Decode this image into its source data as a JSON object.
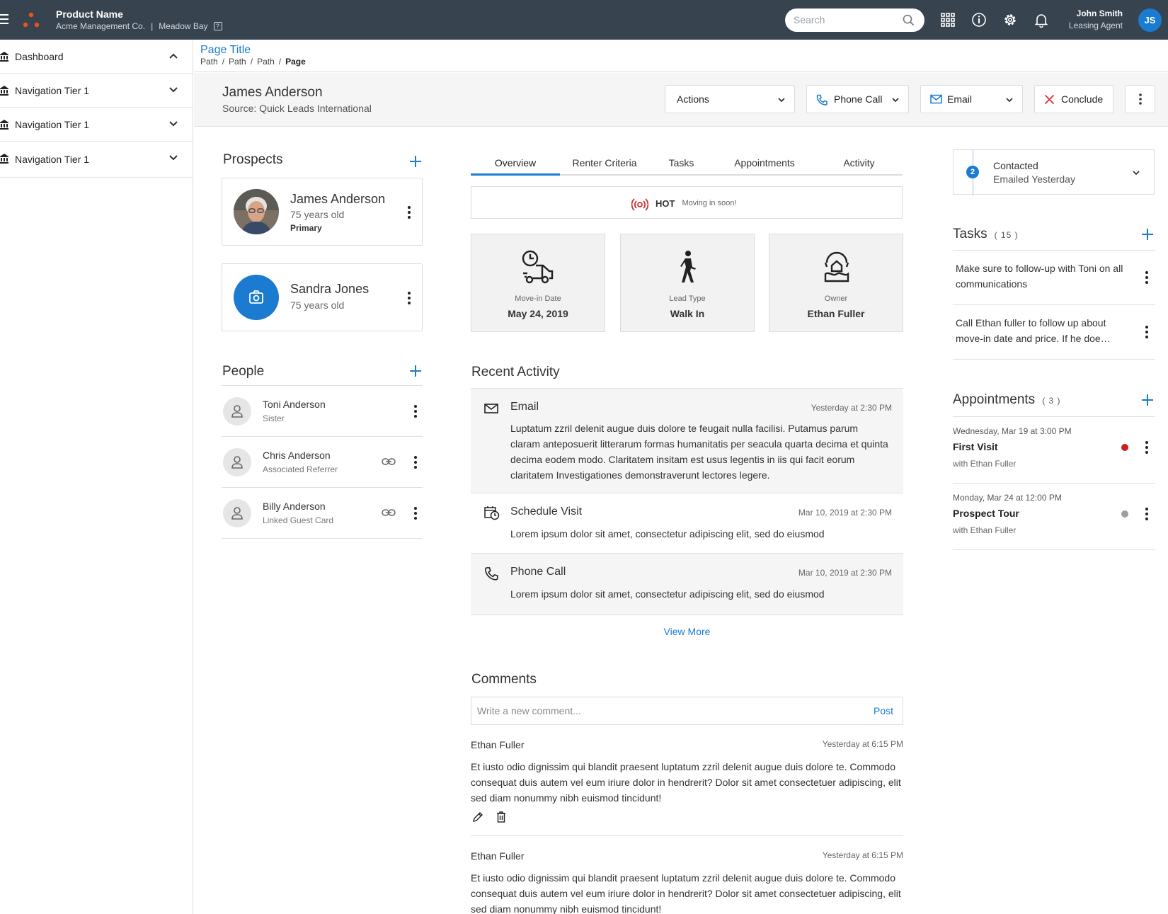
{
  "app": {
    "product_name": "Product Name",
    "company": "Acme Management Co.",
    "separator": "|",
    "property": "Meadow Bay",
    "help_icon": "?",
    "search_placeholder": "Search",
    "user_name": "John Smith",
    "user_role": "Leasing Agent",
    "user_initials": "JS",
    "accent_color": "#1a7bd1",
    "topbar_color": "#37434f",
    "logo_color": "#e8541e"
  },
  "sidebar": {
    "items": [
      {
        "label": "Dashboard",
        "icon": "bank-icon",
        "state": "expanded"
      },
      {
        "label": "Navigation Tier 1",
        "icon": "bank-icon",
        "state": "collapsed"
      },
      {
        "label": "Navigation Tier 1",
        "icon": "bank-icon",
        "state": "collapsed"
      },
      {
        "label": "Navigation Tier 1",
        "icon": "bank-icon",
        "state": "collapsed"
      }
    ]
  },
  "page": {
    "title": "Page Title",
    "breadcrumb": [
      "Path",
      "/",
      "Path",
      "/",
      "Path",
      "/",
      "Page"
    ]
  },
  "record": {
    "name": "James Anderson",
    "source": "Source: Quick Leads International",
    "actions_label": "Actions",
    "phone_label": "Phone Call",
    "email_label": "Email",
    "conclude_label": "Conclude"
  },
  "prospects": {
    "title": "Prospects",
    "items": [
      {
        "name": "James Anderson",
        "age": "75 years old",
        "tag": "Primary"
      },
      {
        "name": "Sandra Jones",
        "age": "75 years old",
        "tag": ""
      }
    ]
  },
  "people": {
    "title": "People",
    "items": [
      {
        "name": "Toni Anderson",
        "relation": "Sister",
        "linked": false
      },
      {
        "name": "Chris Anderson",
        "relation": "Associated Referrer",
        "linked": true
      },
      {
        "name": "Billy Anderson",
        "relation": "Linked Guest Card",
        "linked": true
      }
    ]
  },
  "tabs": [
    "Overview",
    "Renter Criteria",
    "Tasks",
    "Appointments",
    "Activity"
  ],
  "active_tab": "Overview",
  "hot": {
    "label": "HOT",
    "note": "Moving in soon!",
    "color": "#d32f2f"
  },
  "stats": [
    {
      "label": "Move-in Date",
      "value": "May 24, 2019",
      "icon": "moving-truck-icon"
    },
    {
      "label": "Lead Type",
      "value": "Walk In",
      "icon": "walking-person-icon"
    },
    {
      "label": "Owner",
      "value": "Ethan Fuller",
      "icon": "owner-icon"
    }
  ],
  "recent_activity": {
    "title": "Recent Activity",
    "items": [
      {
        "type": "Email",
        "icon": "envelope-icon",
        "date": "Yesterday at 2:30 PM",
        "body": "Luptatum zzril delenit augue duis dolore te feugait nulla facilisi. Putamus parum claram anteposuerit litterarum formas humanitatis per seacula quarta decima et quinta decima eodem modo. Claritatem insitam est usus legentis in iis qui facit eorum claritatem Investigationes demonstraverunt lectores legere."
      },
      {
        "type": "Schedule Visit",
        "icon": "calendar-clock-icon",
        "date": "Mar 10, 2019 at 2:30 PM",
        "body": "Lorem ipsum dolor sit amet, consectetur adipiscing elit, sed do eiusmod"
      },
      {
        "type": "Phone Call",
        "icon": "phone-icon",
        "date": "Mar 10, 2019 at 2:30 PM",
        "body": "Lorem ipsum dolor sit amet, consectetur adipiscing elit, sed do eiusmod"
      }
    ],
    "view_more": "View More"
  },
  "comments": {
    "title": "Comments",
    "placeholder": "Write a new comment...",
    "post_label": "Post",
    "items": [
      {
        "author": "Ethan Fuller",
        "date": "Yesterday at 6:15 PM",
        "body": "Et iusto odio dignissim qui blandit praesent luptatum zzril delenit augue duis dolore te. Commodo consequat duis autem vel eum iriure dolor in hendrerit? Dolor sit amet consectetuer adipiscing, elit sed diam nonummy nibh euismod tincidunt!"
      },
      {
        "author": "Ethan Fuller",
        "date": "Yesterday at 6:15 PM",
        "body": "Et iusto odio dignissim qui blandit praesent luptatum zzril delenit augue duis dolore te. Commodo consequat duis autem vel eum iriure dolor in hendrerit? Dolor sit amet consectetuer adipiscing, elit sed diam nonummy nibh euismod tincidunt!"
      }
    ]
  },
  "status": {
    "step": "2",
    "title": "Contacted",
    "subtitle": "Emailed Yesterday"
  },
  "tasks": {
    "title": "Tasks",
    "count": "( 15 )",
    "items": [
      {
        "text": "Make sure to follow-up with Toni on all communications"
      },
      {
        "text": "Call Ethan fuller to follow up about move-in date and price. If he doe…"
      }
    ]
  },
  "appointments": {
    "title": "Appointments",
    "count": "( 3 )",
    "items": [
      {
        "when": "Wednesday, Mar 19 at 3:00 PM",
        "title": "First Visit",
        "with": "with Ethan Fuller",
        "dot_color": "#d01e1e"
      },
      {
        "when": "Monday, Mar 24 at 12:00 PM",
        "title": "Prospect Tour",
        "with": "with Ethan Fuller",
        "dot_color": "#9e9e9e"
      }
    ]
  }
}
